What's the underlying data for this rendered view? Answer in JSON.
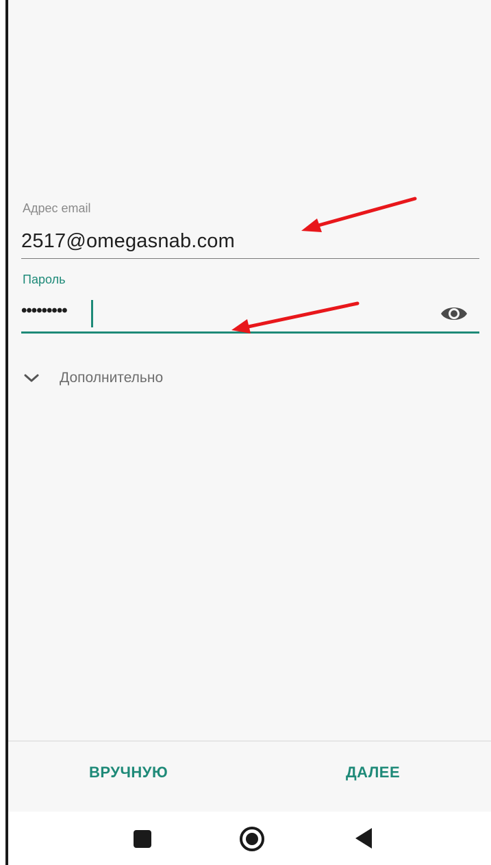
{
  "form": {
    "email": {
      "label": "Адрес email",
      "value": "2517@omegasnab.com"
    },
    "password": {
      "label": "Пароль",
      "masked_value": "•••••••••",
      "visibility_icon": "eye-icon"
    },
    "advanced": {
      "label": "Дополнительно",
      "icon": "chevron-down-icon"
    }
  },
  "actions": {
    "manual_label": "ВРУЧНУЮ",
    "next_label": "ДАЛЕЕ"
  },
  "navbar": {
    "items": [
      "recents-icon",
      "home-icon",
      "back-icon"
    ]
  },
  "colors": {
    "accent": "#1e8a78",
    "annotation_arrow": "#e8171b",
    "background": "#f7f7f7"
  }
}
